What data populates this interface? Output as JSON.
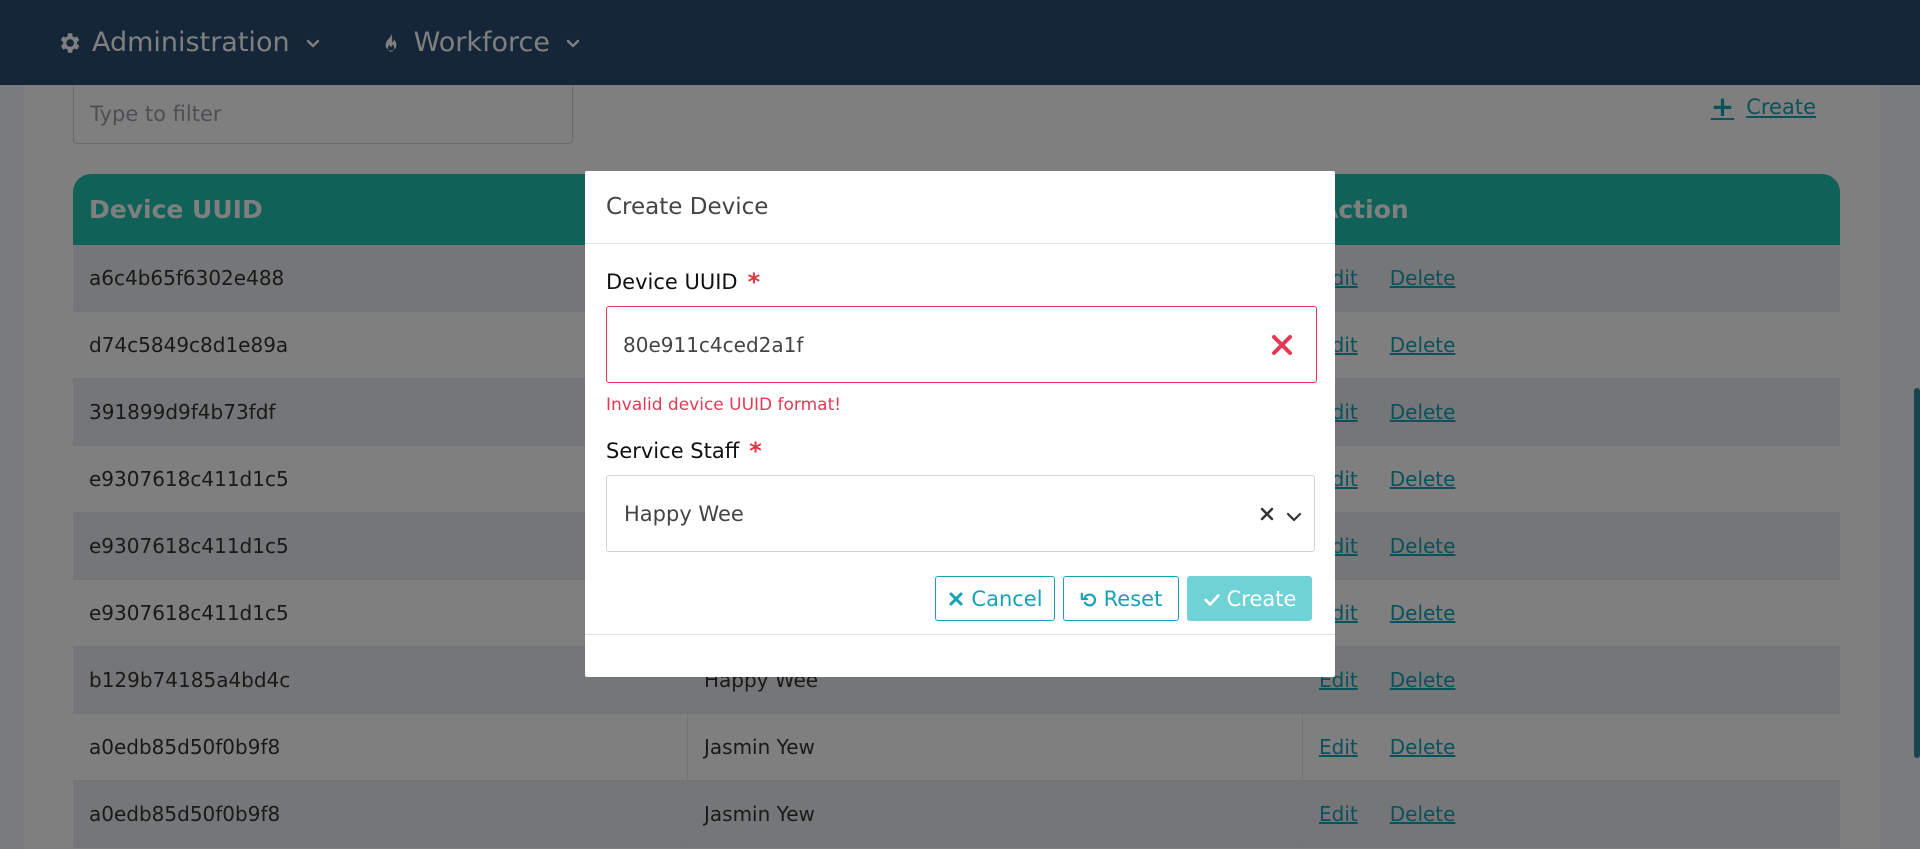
{
  "colors": {
    "nav_bg": "#2b4d72",
    "table_header": "#20c4b2",
    "accent": "#17a2b8",
    "error": "#e23a55",
    "create_button": "#6fd3d6"
  },
  "nav": {
    "items": [
      {
        "label": "Administration",
        "icon": "gear-icon"
      },
      {
        "label": "Workforce",
        "icon": "fire-icon"
      }
    ]
  },
  "page": {
    "filter_placeholder": "Type to filter",
    "create_label": "Create",
    "columns": [
      "Device UUID",
      "",
      "Action"
    ],
    "rows": [
      {
        "uuid": "a6c4b65f6302e488",
        "staff": ""
      },
      {
        "uuid": "d74c5849c8d1e89a",
        "staff": ""
      },
      {
        "uuid": "391899d9f4b73fdf",
        "staff": ""
      },
      {
        "uuid": "e9307618c411d1c5",
        "staff": ""
      },
      {
        "uuid": "e9307618c411d1c5",
        "staff": ""
      },
      {
        "uuid": "e9307618c411d1c5",
        "staff": ""
      },
      {
        "uuid": "b129b74185a4bd4c",
        "staff": "Happy Wee"
      },
      {
        "uuid": "a0edb85d50f0b9f8",
        "staff": "Jasmin Yew"
      },
      {
        "uuid": "a0edb85d50f0b9f8",
        "staff": "Jasmin Yew"
      }
    ],
    "edit_label": "Edit",
    "delete_label": "Delete"
  },
  "modal": {
    "title": "Create Device",
    "uuid_label": "Device UUID",
    "required_mark": "*",
    "uuid_value": "80e911c4ced2a1f",
    "uuid_error": "Invalid device UUID format!",
    "staff_label": "Service Staff",
    "staff_value": "Happy Wee",
    "cancel_label": "Cancel",
    "reset_label": "Reset",
    "create_label": "Create"
  }
}
